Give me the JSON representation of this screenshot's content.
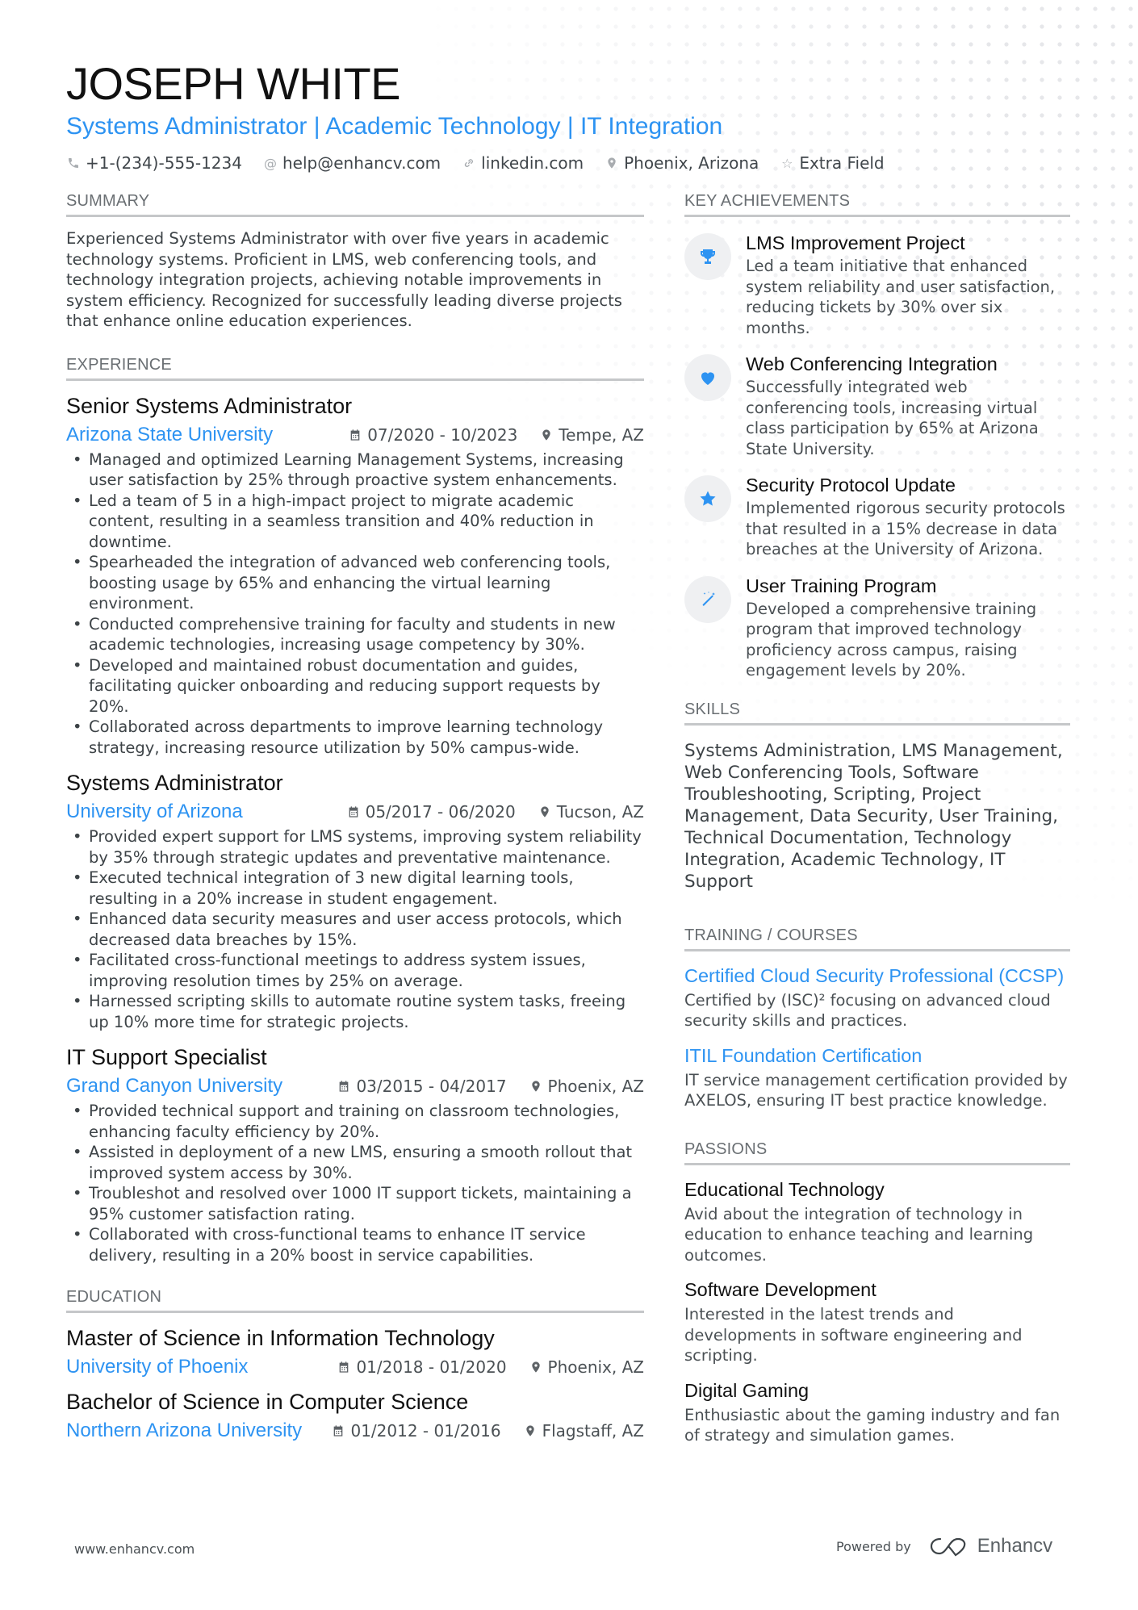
{
  "header": {
    "name": "JOSEPH WHITE",
    "headline": "Systems Administrator | Academic Technology | IT Integration",
    "contacts": [
      {
        "icon": "phone-icon",
        "text": "+1-(234)-555-1234"
      },
      {
        "icon": "at-icon",
        "text": "help@enhancv.com"
      },
      {
        "icon": "link-icon",
        "text": "linkedin.com"
      },
      {
        "icon": "location-icon",
        "text": "Phoenix, Arizona"
      },
      {
        "icon": "star-outline-icon",
        "text": "Extra Field"
      }
    ]
  },
  "sections": {
    "summary": "SUMMARY",
    "experience": "EXPERIENCE",
    "education": "EDUCATION",
    "achievements": "KEY ACHIEVEMENTS",
    "skills": "SKILLS",
    "training": "TRAINING / COURSES",
    "passions": "PASSIONS"
  },
  "summary": "Experienced Systems Administrator with over five years in academic technology systems. Proficient in LMS, web conferencing tools, and technology integration projects, achieving notable improvements in system efficiency. Recognized for successfully leading diverse projects that enhance online education experiences.",
  "experience": [
    {
      "title": "Senior Systems Administrator",
      "company": "Arizona State University",
      "dates": "07/2020 - 10/2023",
      "location": "Tempe, AZ",
      "bullets": [
        "Managed and optimized Learning Management Systems, increasing user satisfaction by 25% through proactive system enhancements.",
        "Led a team of 5 in a high-impact project to migrate academic content, resulting in a seamless transition and 40% reduction in downtime.",
        "Spearheaded the integration of advanced web conferencing tools, boosting usage by 65% and enhancing the virtual learning environment.",
        "Conducted comprehensive training for faculty and students in new academic technologies, increasing usage competency by 30%.",
        "Developed and maintained robust documentation and guides, facilitating quicker onboarding and reducing support requests by 20%.",
        "Collaborated across departments to improve learning technology strategy, increasing resource utilization by 50% campus-wide."
      ]
    },
    {
      "title": "Systems Administrator",
      "company": "University of Arizona",
      "dates": "05/2017 - 06/2020",
      "location": "Tucson, AZ",
      "bullets": [
        "Provided expert support for LMS systems, improving system reliability by 35% through strategic updates and preventative maintenance.",
        "Executed technical integration of 3 new digital learning tools, resulting in a 20% increase in student engagement.",
        "Enhanced data security measures and user access protocols, which decreased data breaches by 15%.",
        "Facilitated cross-functional meetings to address system issues, improving resolution times by 25% on average.",
        "Harnessed scripting skills to automate routine system tasks, freeing up 10% more time for strategic projects."
      ]
    },
    {
      "title": "IT Support Specialist",
      "company": "Grand Canyon University",
      "dates": "03/2015 - 04/2017",
      "location": "Phoenix, AZ",
      "bullets": [
        "Provided technical support and training on classroom technologies, enhancing faculty efficiency by 20%.",
        "Assisted in deployment of a new LMS, ensuring a smooth rollout that improved system access by 30%.",
        "Troubleshot and resolved over 1000 IT support tickets, maintaining a 95% customer satisfaction rating.",
        "Collaborated with cross-functional teams to enhance IT service delivery, resulting in a 20% boost in service capabilities."
      ]
    }
  ],
  "education": [
    {
      "degree": "Master of Science in Information Technology",
      "school": "University of Phoenix",
      "dates": "01/2018 - 01/2020",
      "location": "Phoenix, AZ"
    },
    {
      "degree": "Bachelor of Science in Computer Science",
      "school": "Northern Arizona University",
      "dates": "01/2012 - 01/2016",
      "location": "Flagstaff, AZ"
    }
  ],
  "achievements": [
    {
      "icon": "trophy-icon",
      "title": "LMS Improvement Project",
      "desc": "Led a team initiative that enhanced system reliability and user satisfaction, reducing tickets by 30% over six months."
    },
    {
      "icon": "heart-icon",
      "title": "Web Conferencing Integration",
      "desc": "Successfully integrated web conferencing tools, increasing virtual class participation by 65% at Arizona State University."
    },
    {
      "icon": "star-icon",
      "title": "Security Protocol Update",
      "desc": "Implemented rigorous security protocols that resulted in a 15% decrease in data breaches at the University of Arizona."
    },
    {
      "icon": "magic-wand-icon",
      "title": "User Training Program",
      "desc": "Developed a comprehensive training program that improved technology proficiency across campus, raising engagement levels by 20%."
    }
  ],
  "skills": "Systems Administration, LMS Management, Web Conferencing Tools, Software Troubleshooting, Scripting, Project Management, Data Security, User Training, Technical Documentation, Technology Integration, Academic Technology, IT Support",
  "training": [
    {
      "title": "Certified Cloud Security Professional (CCSP)",
      "desc": "Certified by (ISC)² focusing on advanced cloud security skills and practices."
    },
    {
      "title": "ITIL Foundation Certification",
      "desc": "IT service management certification provided by AXELOS, ensuring IT best practice knowledge."
    }
  ],
  "passions": [
    {
      "title": "Educational Technology",
      "desc": "Avid about the integration of technology in education to enhance teaching and learning outcomes."
    },
    {
      "title": "Software Development",
      "desc": "Interested in the latest trends and developments in software engineering and scripting."
    },
    {
      "title": "Digital Gaming",
      "desc": "Enthusiastic about the gaming industry and fan of strategy and simulation games."
    }
  ],
  "footer": {
    "website": "www.enhancv.com",
    "powered_by": "Powered by",
    "brand": "Enhancv"
  },
  "colors": {
    "accent": "#2d93f2",
    "text": "#3d4347",
    "heading": "#111111",
    "rule": "#c5c7c9"
  }
}
